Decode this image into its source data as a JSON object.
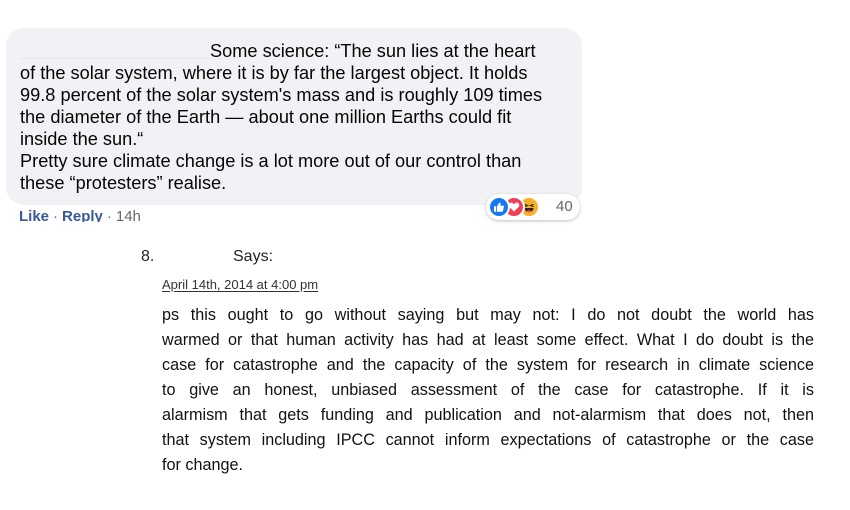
{
  "fb_comment": {
    "text_lines": [
      "Some science: “The sun lies at the heart",
      "of the solar system, where it is by far the largest object. It holds",
      "99.8 percent of the solar system's mass and is roughly 109 times",
      "the diameter of the Earth — about one million Earths could fit",
      "inside the sun.“",
      "Pretty sure climate change is a lot more out of our control than",
      "these “protesters” realise."
    ],
    "reactions": {
      "icons": [
        "like-icon",
        "love-icon",
        "haha-icon"
      ],
      "count": "40"
    },
    "actions": {
      "like": "Like",
      "reply": "Reply",
      "separator": "·",
      "time": "14h"
    },
    "colors": {
      "bubble": "#f0f2f5",
      "like": "#1877f2",
      "love": "#f33e58",
      "haha": "#f7b125",
      "muted": "#65676b"
    }
  },
  "blog_comment": {
    "number": "8.",
    "says": "Says:",
    "date": "April 14th, 2014 at 4:00 pm",
    "body_lines": [
      "ps this ought to go without saying but may not: I do not doubt the world has",
      "warmed or that human activity has had at least some effect. What I do doubt is the",
      "case for catastrophe and the capacity of the system for research in climate science",
      "to give an honest, unbiased assessment of the case for catastrophe. If it is",
      "alarmism that gets funding and publication and not-alarmism that does not, then",
      "that system including IPCC cannot inform expectations of catastrophe or the case",
      "for change."
    ]
  }
}
